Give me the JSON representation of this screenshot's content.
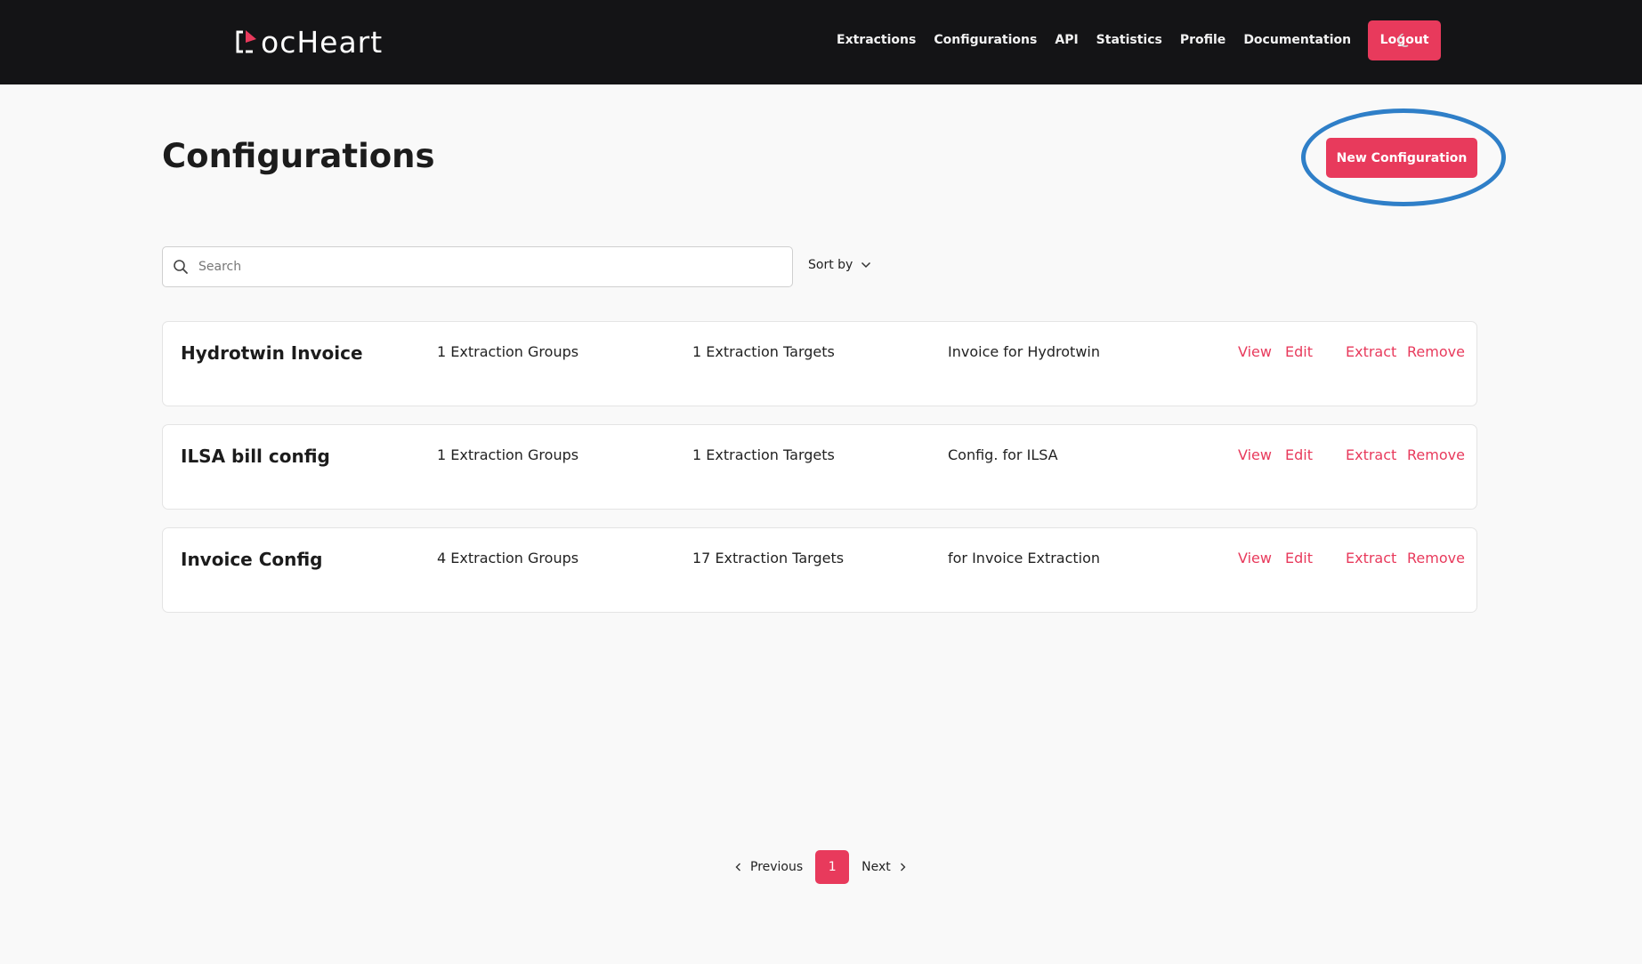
{
  "brand": {
    "logo_text": "ocHeart",
    "accent_color": "#e83a5c"
  },
  "nav": {
    "items": [
      {
        "label": "Extractions"
      },
      {
        "label": "Configurations"
      },
      {
        "label": "API"
      },
      {
        "label": "Statistics"
      },
      {
        "label": "Profile"
      },
      {
        "label": "Documentation"
      }
    ],
    "logout_label": "Logout",
    "theme_icon": "moon-icon"
  },
  "page": {
    "title": "Configurations",
    "new_button_label": "New Configuration",
    "highlight_color": "#2f7fc8"
  },
  "search": {
    "placeholder": "Search",
    "value": ""
  },
  "sort": {
    "label": "Sort by"
  },
  "configs": [
    {
      "name": "Hydrotwin Invoice",
      "groups": "1 Extraction Groups",
      "targets": "1 Extraction Targets",
      "description": "Invoice for Hydrotwin"
    },
    {
      "name": "ILSA bill config",
      "groups": "1 Extraction Groups",
      "targets": "1 Extraction Targets",
      "description": "Config. for ILSA"
    },
    {
      "name": "Invoice Config",
      "groups": "4 Extraction Groups",
      "targets": "17 Extraction Targets",
      "description": "for Invoice Extraction"
    }
  ],
  "actions": {
    "view": "View",
    "edit": "Edit",
    "extract": "Extract",
    "remove": "Remove"
  },
  "pagination": {
    "previous": "Previous",
    "current": "1",
    "next": "Next"
  }
}
